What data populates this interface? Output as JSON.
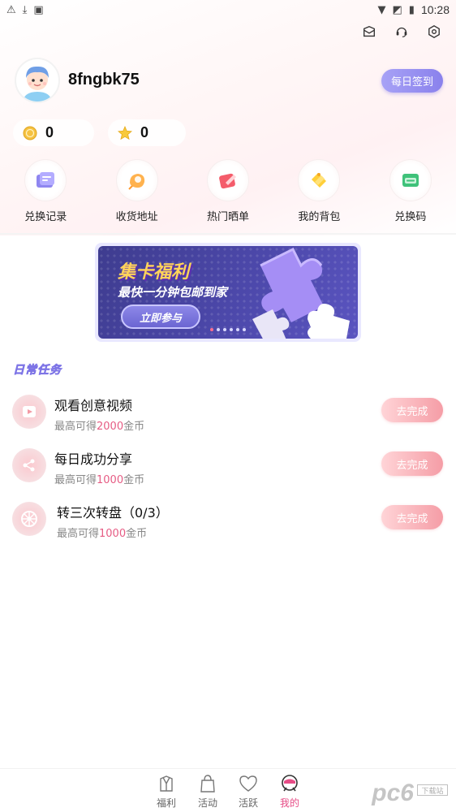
{
  "status_bar": {
    "time": "10:28"
  },
  "profile": {
    "username": "8fngbk75",
    "checkin_label": "每日签到"
  },
  "wallet": {
    "coins": "0",
    "stars": "0"
  },
  "shortcuts": [
    {
      "label": "兑换记录",
      "icon": "redeem-record-icon"
    },
    {
      "label": "收货地址",
      "icon": "address-icon"
    },
    {
      "label": "热门晒单",
      "icon": "showcase-icon"
    },
    {
      "label": "我的背包",
      "icon": "backpack-icon"
    },
    {
      "label": "兑换码",
      "icon": "redeem-code-icon"
    }
  ],
  "banner": {
    "title": "集卡福利",
    "subtitle": "最快一分钟包邮到家",
    "cta": "立即参与",
    "pages": 6,
    "active_page": 0
  },
  "daily_tasks": {
    "title": "日常任务",
    "items": [
      {
        "title": "观看创意视频",
        "reward_prefix": "最高可得",
        "reward_amount": "2000",
        "reward_unit": "金币",
        "button": "去完成",
        "icon": "video-icon"
      },
      {
        "title": "每日成功分享",
        "reward_prefix": "最高可得",
        "reward_amount": "1000",
        "reward_unit": "金币",
        "button": "去完成",
        "icon": "share-icon"
      },
      {
        "title": "转三次转盘（0/3）",
        "reward_prefix": "最高可得",
        "reward_amount": "1000",
        "reward_unit": "金币",
        "button": "去完成",
        "icon": "wheel-icon"
      }
    ]
  },
  "tabbar": [
    {
      "label": "福利",
      "icon": "gift-icon",
      "active": false
    },
    {
      "label": "活动",
      "icon": "bag-icon",
      "active": false
    },
    {
      "label": "活跃",
      "icon": "heart-icon",
      "active": false
    },
    {
      "label": "我的",
      "icon": "profile-icon",
      "active": true
    }
  ],
  "colors": {
    "accent": "#e64c86",
    "checkin": "#8a81ec",
    "task_button": "#f59da6"
  },
  "watermark": {
    "text": "pc6",
    "sub": "下载站"
  }
}
